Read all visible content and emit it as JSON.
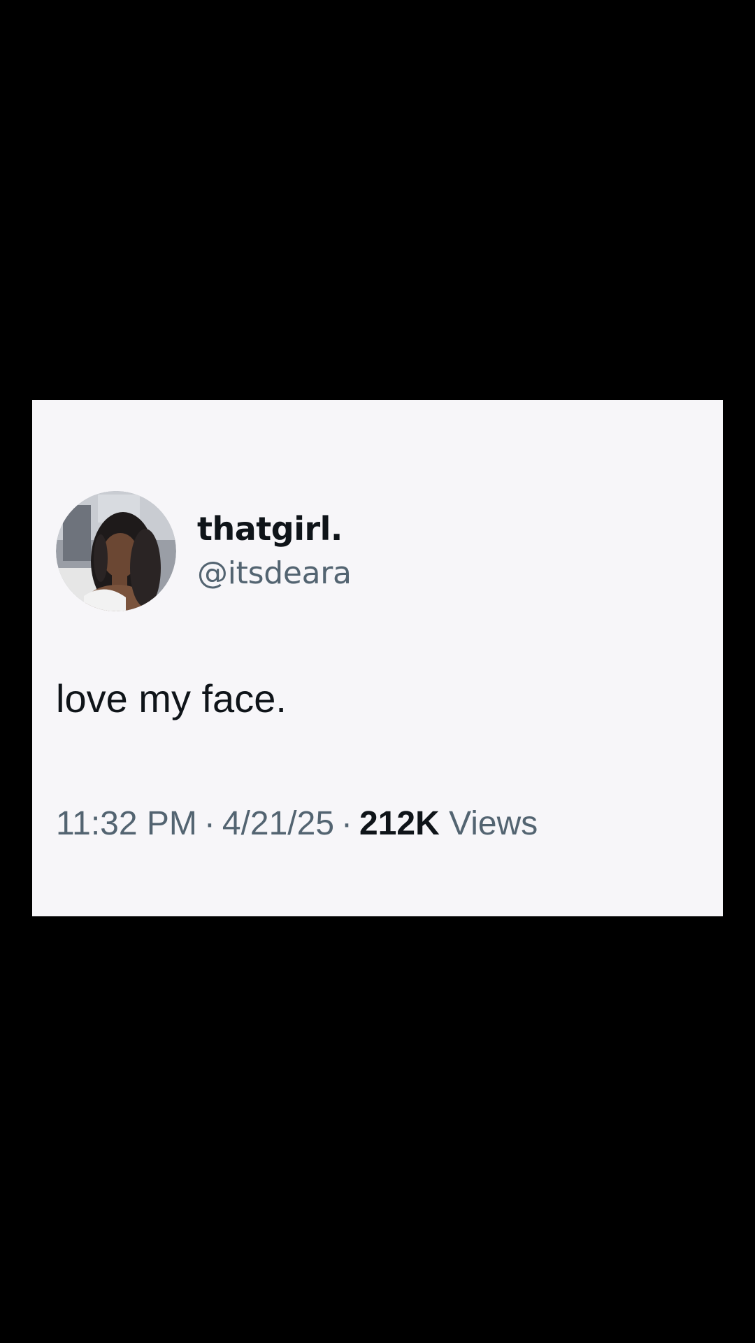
{
  "tweet": {
    "display_name": "thatgirl.",
    "handle": "@itsdeara",
    "text": "love my face.",
    "time": "11:32 PM",
    "separator": "·",
    "date": "4/21/25",
    "views_count": "212K",
    "views_label": "Views"
  },
  "colors": {
    "background": "#000000",
    "card": "#f7f6f9",
    "primary_text": "#0f1419",
    "secondary_text": "#536471"
  }
}
